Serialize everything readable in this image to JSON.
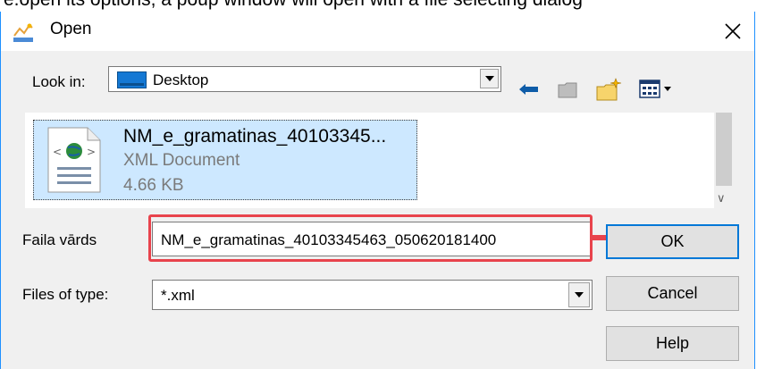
{
  "top_text": "e.open its options, a poup window will open with a file selecting dialog",
  "dialog": {
    "title": "Open",
    "icons": {
      "app": "options-app-icon",
      "close": "close-icon"
    }
  },
  "look_in": {
    "label": "Look in:",
    "value": "Desktop"
  },
  "toolbar": {
    "icons": [
      "back-arrow-icon",
      "up-folder-icon",
      "new-folder-icon",
      "view-menu-icon"
    ]
  },
  "files": [
    {
      "name": "NM_e_gramatinas_40103345...",
      "type": "XML Document",
      "size": "4.66 KB",
      "icon": "xml-document-icon"
    }
  ],
  "filename": {
    "label": "Faila vārds",
    "value": "NM_e_gramatinas_40103345463_050620181400"
  },
  "filetype": {
    "label": "Files of type:",
    "value": "*.xml"
  },
  "buttons": {
    "ok": "OK",
    "cancel": "Cancel",
    "help": "Help"
  },
  "colors": {
    "selection": "#cde8ff",
    "highlight": "#e8434c",
    "accent": "#0078d7"
  }
}
